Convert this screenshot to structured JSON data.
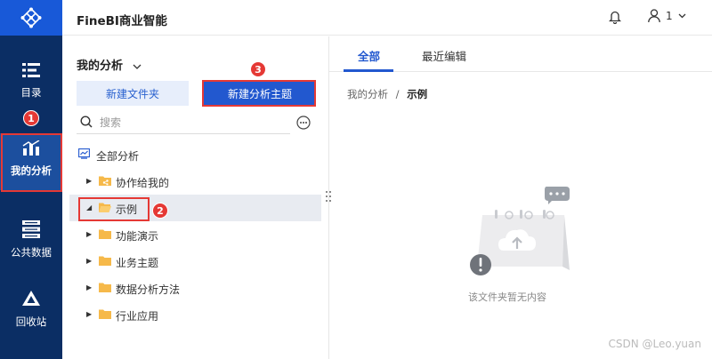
{
  "app": {
    "title": "FineBI商业智能"
  },
  "user": {
    "label": "1"
  },
  "nav": {
    "items": [
      {
        "label": "目录"
      },
      {
        "label": "我的分析"
      },
      {
        "label": "公共数据"
      },
      {
        "label": "回收站"
      }
    ]
  },
  "panel": {
    "title": "我的分析",
    "new_folder_label": "新建文件夹",
    "new_subject_label": "新建分析主题",
    "search_placeholder": "搜索",
    "tree": [
      {
        "label": "全部分析"
      },
      {
        "label": "协作给我的"
      },
      {
        "label": "示例"
      },
      {
        "label": "功能演示"
      },
      {
        "label": "业务主题"
      },
      {
        "label": "数据分析方法"
      },
      {
        "label": "行业应用"
      }
    ]
  },
  "content": {
    "tabs": [
      {
        "label": "全部"
      },
      {
        "label": "最近编辑"
      }
    ],
    "breadcrumb": {
      "parent": "我的分析",
      "separator": "/",
      "current": "示例"
    },
    "empty_text": "该文件夹暂无内容"
  },
  "annotations": {
    "m1": "1",
    "m2": "2",
    "m3": "3"
  },
  "watermark": "CSDN @Leo.yuan",
  "colors": {
    "nav_bg": "#0b2e64",
    "accent": "#2258cf",
    "logo_bg": "#1859d8",
    "marker": "#e53935",
    "folder": "#f6b94a"
  }
}
